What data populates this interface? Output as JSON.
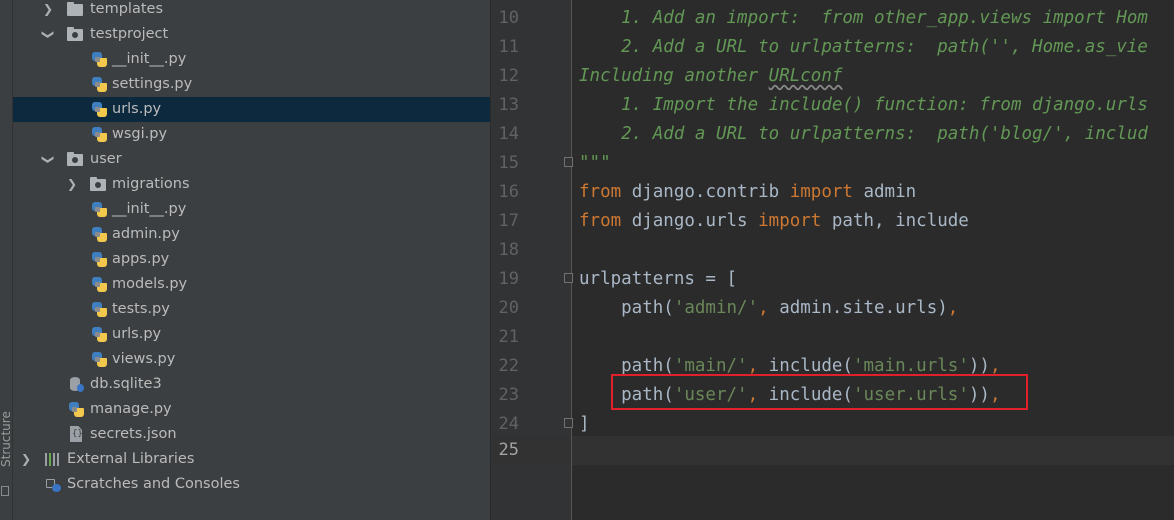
{
  "strip": {
    "label": "Structure"
  },
  "tree": {
    "items": [
      {
        "label": "templates"
      },
      {
        "label": "testproject"
      },
      {
        "label": "__init__.py"
      },
      {
        "label": "settings.py"
      },
      {
        "label": "urls.py"
      },
      {
        "label": "wsgi.py"
      },
      {
        "label": "user"
      },
      {
        "label": "migrations"
      },
      {
        "label": "__init__.py"
      },
      {
        "label": "admin.py"
      },
      {
        "label": "apps.py"
      },
      {
        "label": "models.py"
      },
      {
        "label": "tests.py"
      },
      {
        "label": "urls.py"
      },
      {
        "label": "views.py"
      },
      {
        "label": "db.sqlite3"
      },
      {
        "label": "manage.py"
      },
      {
        "label": "secrets.json"
      },
      {
        "label": "External Libraries"
      },
      {
        "label": "Scratches and Consoles"
      }
    ],
    "selected_item": "urls.py",
    "icon_names": {
      "folder": "folder-icon",
      "python": "python-file-icon",
      "database": "database-file-icon",
      "json": "json-file-icon",
      "libraries": "libraries-icon",
      "scratches": "scratches-icon"
    }
  },
  "editor": {
    "line_numbers": [
      "10",
      "11",
      "12",
      "13",
      "14",
      "15",
      "16",
      "17",
      "18",
      "19",
      "20",
      "21",
      "22",
      "23",
      "24",
      "25"
    ],
    "current_line": "25",
    "lines": {
      "l10": "    1. Add an import:  from other_app.views import Hom",
      "l11": "    2. Add a URL to urlpatterns:  path('', Home.as_vie",
      "l12a": "Including another ",
      "l12b": "URLconf",
      "l13": "    1. Import the include() function: from django.urls",
      "l14": "    2. Add a URL to urlpatterns:  path('blog/', includ",
      "l15": "\"\"\"",
      "l16_kw1": "from",
      "l16_mod": " django.contrib ",
      "l16_kw2": "import",
      "l16_name": " admin",
      "l17_kw1": "from",
      "l17_mod": " django.urls ",
      "l17_kw2": "import",
      "l17_name": " path, include",
      "l19": "urlpatterns = [",
      "l20_a": "    path(",
      "l20_str": "'admin/'",
      "l20_comma": ",",
      "l20_b": " admin.site.urls)",
      "l20_end": ",",
      "l22_a": "    path(",
      "l22_str1": "'main/'",
      "l22_comma": ",",
      "l22_b": " include(",
      "l22_str2": "'main.urls'",
      "l22_c": "))",
      "l22_end": ",",
      "l23_a": "    path(",
      "l23_str1": "'user/'",
      "l23_comma": ",",
      "l23_b": " include(",
      "l23_str2": "'user.urls'",
      "l23_c": "))",
      "l23_end": ",",
      "l24": "]"
    },
    "colors": {
      "docstring": "#629755",
      "keyword": "#cc7832",
      "string": "#6a8759",
      "text": "#a9b7c6",
      "highlight_box": "#e0202a"
    }
  }
}
